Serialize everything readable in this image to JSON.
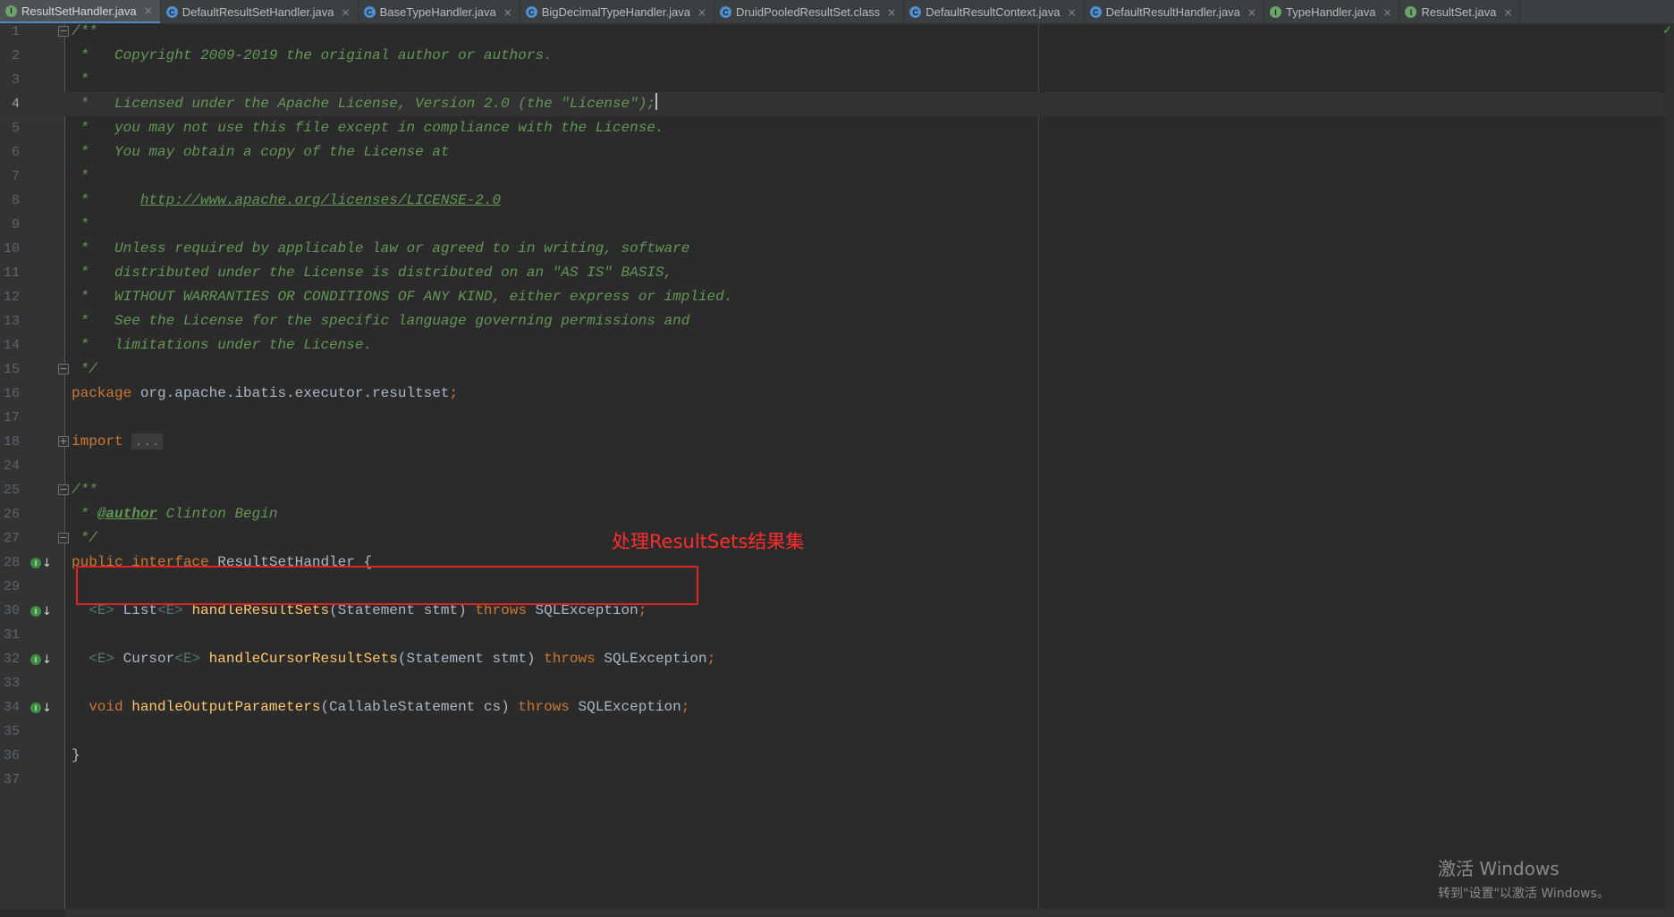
{
  "tabs": [
    {
      "label": "ResultSetHandler.java",
      "icon": "interface-icon",
      "icon_letter": "I",
      "icon_color": "#6ba56b",
      "active": true
    },
    {
      "label": "DefaultResultSetHandler.java",
      "icon": "class-icon",
      "icon_letter": "C",
      "icon_color": "#4e8fd0",
      "active": false
    },
    {
      "label": "BaseTypeHandler.java",
      "icon": "abstract-class-icon",
      "icon_letter": "C",
      "icon_color": "#4e8fd0",
      "active": false
    },
    {
      "label": "BigDecimalTypeHandler.java",
      "icon": "class-icon",
      "icon_letter": "C",
      "icon_color": "#4e8fd0",
      "active": false
    },
    {
      "label": "DruidPooledResultSet.class",
      "icon": "compiled-class-icon",
      "icon_letter": "C",
      "icon_color": "#4e8fd0",
      "active": false
    },
    {
      "label": "DefaultResultContext.java",
      "icon": "class-icon",
      "icon_letter": "C",
      "icon_color": "#4e8fd0",
      "active": false
    },
    {
      "label": "DefaultResultHandler.java",
      "icon": "class-icon",
      "icon_letter": "C",
      "icon_color": "#4e8fd0",
      "active": false
    },
    {
      "label": "TypeHandler.java",
      "icon": "interface-icon",
      "icon_letter": "I",
      "icon_color": "#6ba56b",
      "active": false
    },
    {
      "label": "ResultSet.java",
      "icon": "interface-icon",
      "icon_letter": "I",
      "icon_color": "#6ba56b",
      "active": false
    }
  ],
  "tab_close_glyph": "×",
  "lines": [
    {
      "n": "1",
      "fold": "minus",
      "code": [
        {
          "t": "/**",
          "c": "doc"
        }
      ]
    },
    {
      "n": "2",
      "code": [
        {
          "t": " *   Copyright 2009-2019 the original author or authors.",
          "c": "doc"
        }
      ]
    },
    {
      "n": "3",
      "code": [
        {
          "t": " *",
          "c": "doc"
        }
      ]
    },
    {
      "n": "4",
      "current": true,
      "code": [
        {
          "t": " *   Licensed under the Apache License, Version 2.0 (the \"License\");",
          "c": "doc"
        },
        {
          "cursor": true
        }
      ]
    },
    {
      "n": "5",
      "code": [
        {
          "t": " *   you may not use this file except in compliance with the License.",
          "c": "doc"
        }
      ]
    },
    {
      "n": "6",
      "code": [
        {
          "t": " *   You may obtain a copy of the License at",
          "c": "doc"
        }
      ]
    },
    {
      "n": "7",
      "code": [
        {
          "t": " *",
          "c": "doc"
        }
      ]
    },
    {
      "n": "8",
      "code": [
        {
          "t": " *      ",
          "c": "doc"
        },
        {
          "t": "http://www.apache.org/licenses/LICENSE-2.0",
          "c": "link"
        }
      ]
    },
    {
      "n": "9",
      "code": [
        {
          "t": " *",
          "c": "doc"
        }
      ]
    },
    {
      "n": "10",
      "code": [
        {
          "t": " *   Unless required by applicable law or agreed to in writing, software",
          "c": "doc"
        }
      ]
    },
    {
      "n": "11",
      "code": [
        {
          "t": " *   distributed under the License is distributed on an \"AS IS\" BASIS,",
          "c": "doc"
        }
      ]
    },
    {
      "n": "12",
      "code": [
        {
          "t": " *   WITHOUT WARRANTIES OR CONDITIONS OF ANY KIND, either express or implied.",
          "c": "doc"
        }
      ]
    },
    {
      "n": "13",
      "code": [
        {
          "t": " *   See the License for the specific language governing permissions and",
          "c": "doc"
        }
      ]
    },
    {
      "n": "14",
      "code": [
        {
          "t": " *   limitations under the License.",
          "c": "doc"
        }
      ]
    },
    {
      "n": "15",
      "fold": "minus",
      "code": [
        {
          "t": " */",
          "c": "doc"
        }
      ]
    },
    {
      "n": "16",
      "code": [
        {
          "t": "package",
          "c": "kw"
        },
        {
          "t": " org.apache.ibatis.executor.resultset",
          "c": "type"
        },
        {
          "t": ";",
          "c": "kw"
        }
      ]
    },
    {
      "n": "17",
      "code": []
    },
    {
      "n": "18",
      "fold": "plus",
      "code": [
        {
          "t": "import ",
          "c": "kw"
        },
        {
          "t": "...",
          "c": "fold"
        }
      ]
    },
    {
      "n": "24",
      "code": []
    },
    {
      "n": "25",
      "fold": "minus",
      "code": [
        {
          "t": "/**",
          "c": "doc"
        }
      ]
    },
    {
      "n": "26",
      "code": [
        {
          "t": " * ",
          "c": "doc"
        },
        {
          "t": "@author",
          "c": "tag"
        },
        {
          "t": " Clinton Begin",
          "c": "doc"
        }
      ]
    },
    {
      "n": "27",
      "fold": "minus",
      "code": [
        {
          "t": " */",
          "c": "doc"
        }
      ]
    },
    {
      "n": "28",
      "impl": true,
      "code": [
        {
          "t": "public interface",
          "c": "kw"
        },
        {
          "t": " ResultSetHandler {",
          "c": "type"
        }
      ]
    },
    {
      "n": "29",
      "code": []
    },
    {
      "n": "30",
      "impl": true,
      "code": [
        {
          "t": "  <E>",
          "c": "gen"
        },
        {
          "t": " List",
          "c": "type"
        },
        {
          "t": "<E>",
          "c": "gen"
        },
        {
          "t": " ",
          "c": "type"
        },
        {
          "t": "handleResultSets",
          "c": "fn"
        },
        {
          "t": "(Statement stmt) ",
          "c": "type"
        },
        {
          "t": "throws",
          "c": "kw"
        },
        {
          "t": " SQLException",
          "c": "type"
        },
        {
          "t": ";",
          "c": "kw"
        }
      ]
    },
    {
      "n": "31",
      "code": []
    },
    {
      "n": "32",
      "impl": true,
      "code": [
        {
          "t": "  <E>",
          "c": "gen"
        },
        {
          "t": " Cursor",
          "c": "type"
        },
        {
          "t": "<E>",
          "c": "gen"
        },
        {
          "t": " ",
          "c": "type"
        },
        {
          "t": "handleCursorResultSets",
          "c": "fn"
        },
        {
          "t": "(Statement stmt) ",
          "c": "type"
        },
        {
          "t": "throws",
          "c": "kw"
        },
        {
          "t": " SQLException",
          "c": "type"
        },
        {
          "t": ";",
          "c": "kw"
        }
      ]
    },
    {
      "n": "33",
      "code": []
    },
    {
      "n": "34",
      "impl": true,
      "code": [
        {
          "t": "  void",
          "c": "kw"
        },
        {
          "t": " ",
          "c": "type"
        },
        {
          "t": "handleOutputParameters",
          "c": "fn"
        },
        {
          "t": "(CallableStatement cs) ",
          "c": "type"
        },
        {
          "t": "throws",
          "c": "kw"
        },
        {
          "t": " SQLException",
          "c": "type"
        },
        {
          "t": ";",
          "c": "kw"
        }
      ]
    },
    {
      "n": "35",
      "code": []
    },
    {
      "n": "36",
      "code": [
        {
          "t": "}",
          "c": "type"
        }
      ]
    },
    {
      "n": "37",
      "code": []
    }
  ],
  "impl_marker_letter": "I",
  "impl_arrow_glyph": "↓",
  "annotation": {
    "label": "处理ResultSets结果集",
    "color": "#e02424"
  },
  "watermark": {
    "line1": "激活 Windows",
    "line2": "转到\"设置\"以激活 Windows。"
  },
  "status_check": "✓",
  "colors": {
    "keyword": "#cc7832",
    "method": "#ffc66d",
    "doc_comment": "#629755",
    "text": "#a9b7c6",
    "background": "#2b2b2b"
  }
}
